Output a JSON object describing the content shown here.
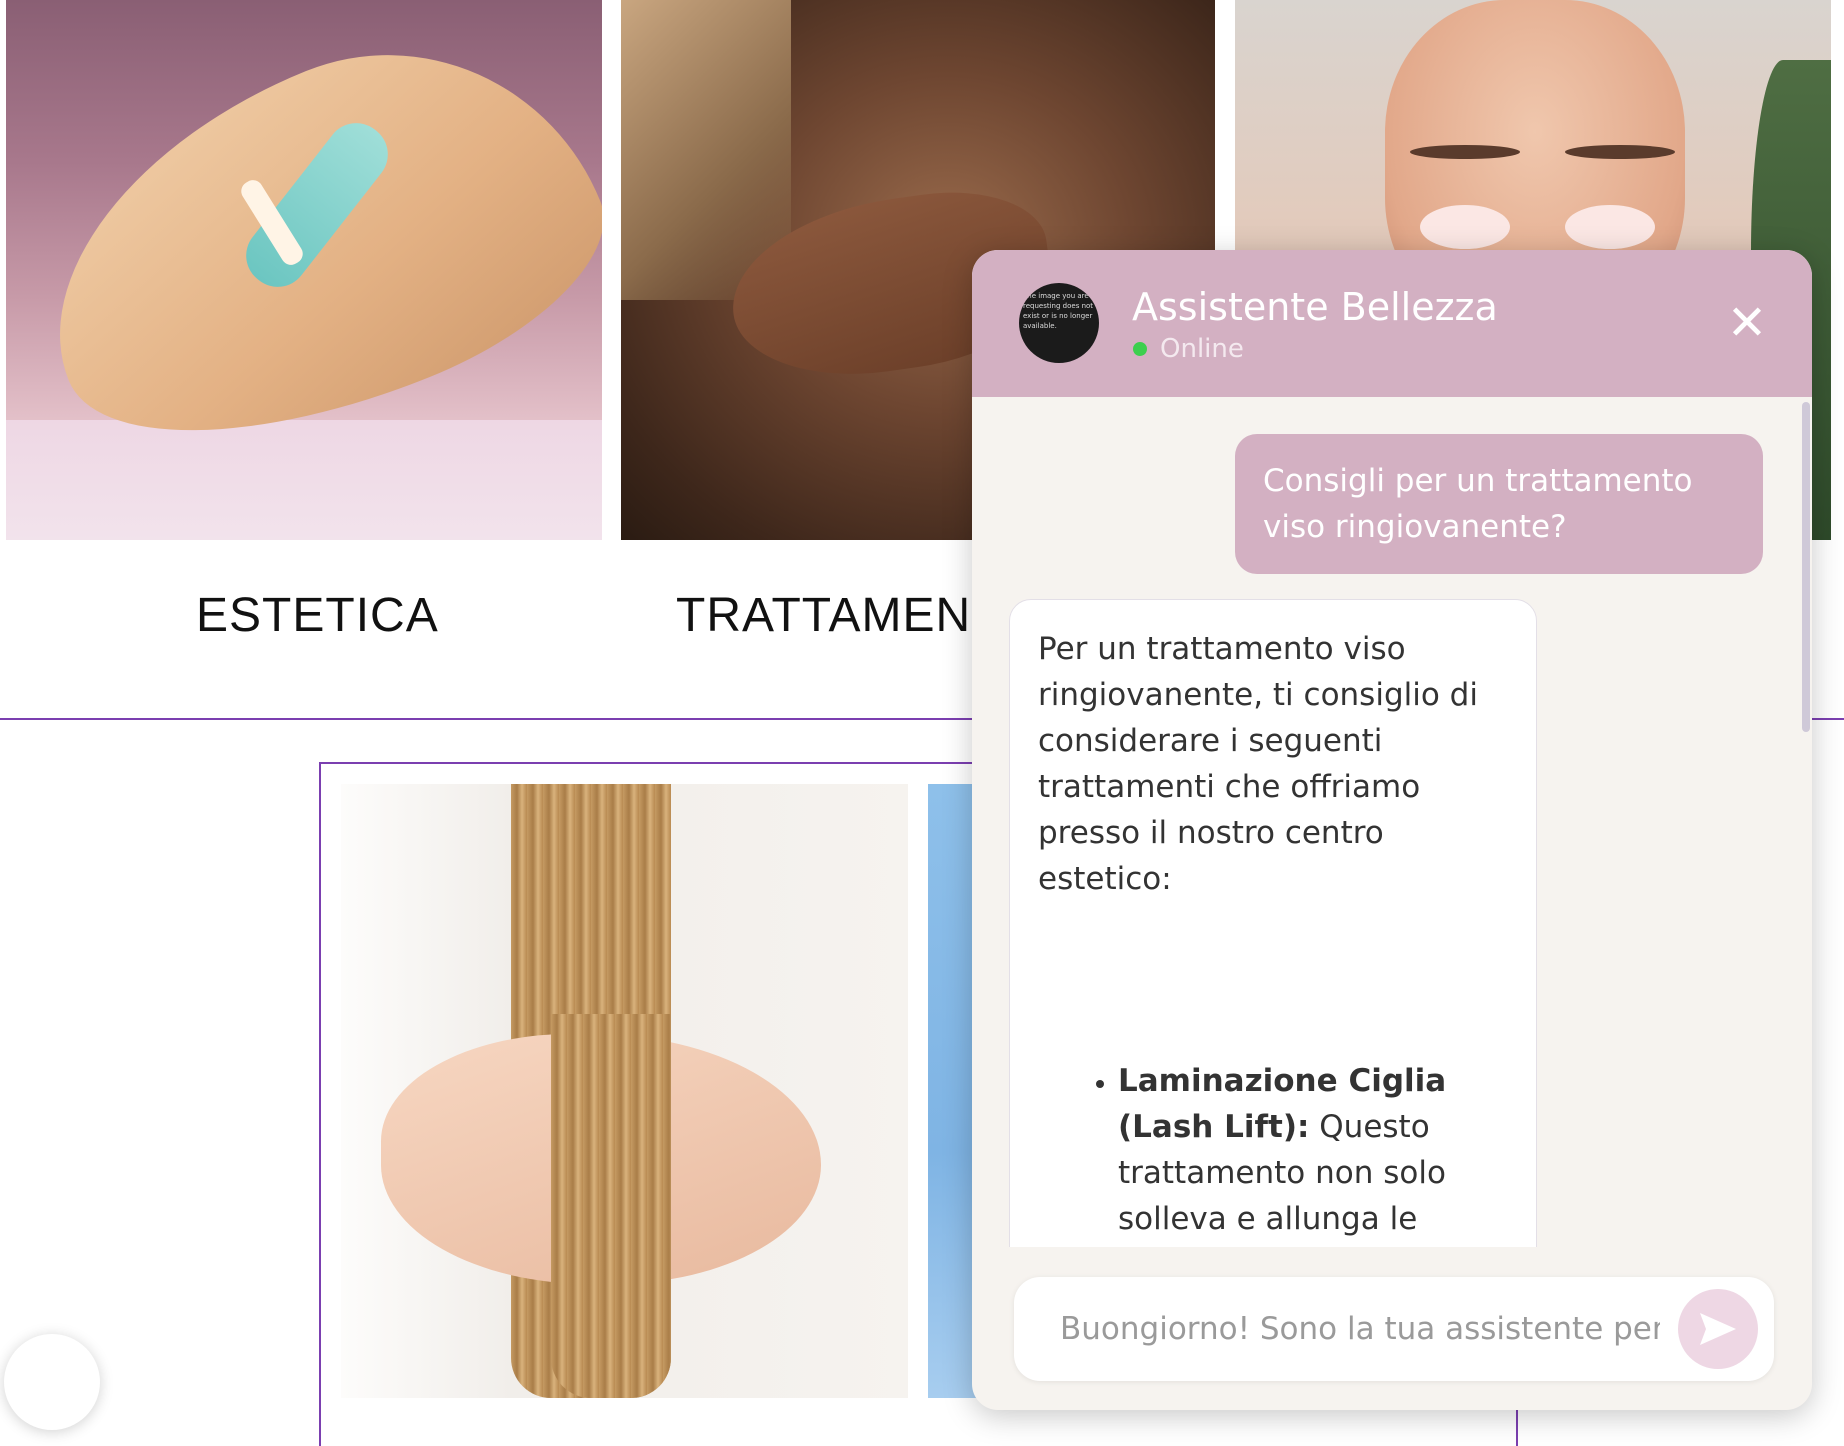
{
  "gallery": {
    "top": [
      {
        "label": "ESTETICA",
        "image": "leg-waxing-photo"
      },
      {
        "label": "TRATTAMENT",
        "image": "back-massage-photo"
      },
      {
        "label": "",
        "image": "facial-treatment-photo"
      }
    ],
    "bottom": [
      {
        "image": "hair-care-photo"
      },
      {
        "image": "blue-photo"
      }
    ]
  },
  "chat": {
    "title": "Assistente Bellezza",
    "status": "Online",
    "avatar_text": "The image you are requesting does not exist or is no longer available.",
    "close_icon": "close-icon",
    "messages": {
      "user": "Consigli per un trattamento viso ringiovanente?",
      "bot_intro": "Per un trattamento viso ringiovanente, ti consiglio di considerare i seguenti trattamenti che offriamo presso il nostro centro estetico:",
      "bot_item_title": "Laminazione Ciglia (Lash Lift):",
      "bot_item_text": "Questo trattamento non solo solleva e allunga le ciglia, ma apre e ringiovanisce lo sguardo,"
    },
    "input": {
      "placeholder": "Buongiorno! Sono la tua assistente perso",
      "value": ""
    },
    "send_icon": "send-icon"
  },
  "colors": {
    "accent": "#d3b0c2",
    "divider": "#7b3fb0",
    "online": "#3ccf4e"
  }
}
